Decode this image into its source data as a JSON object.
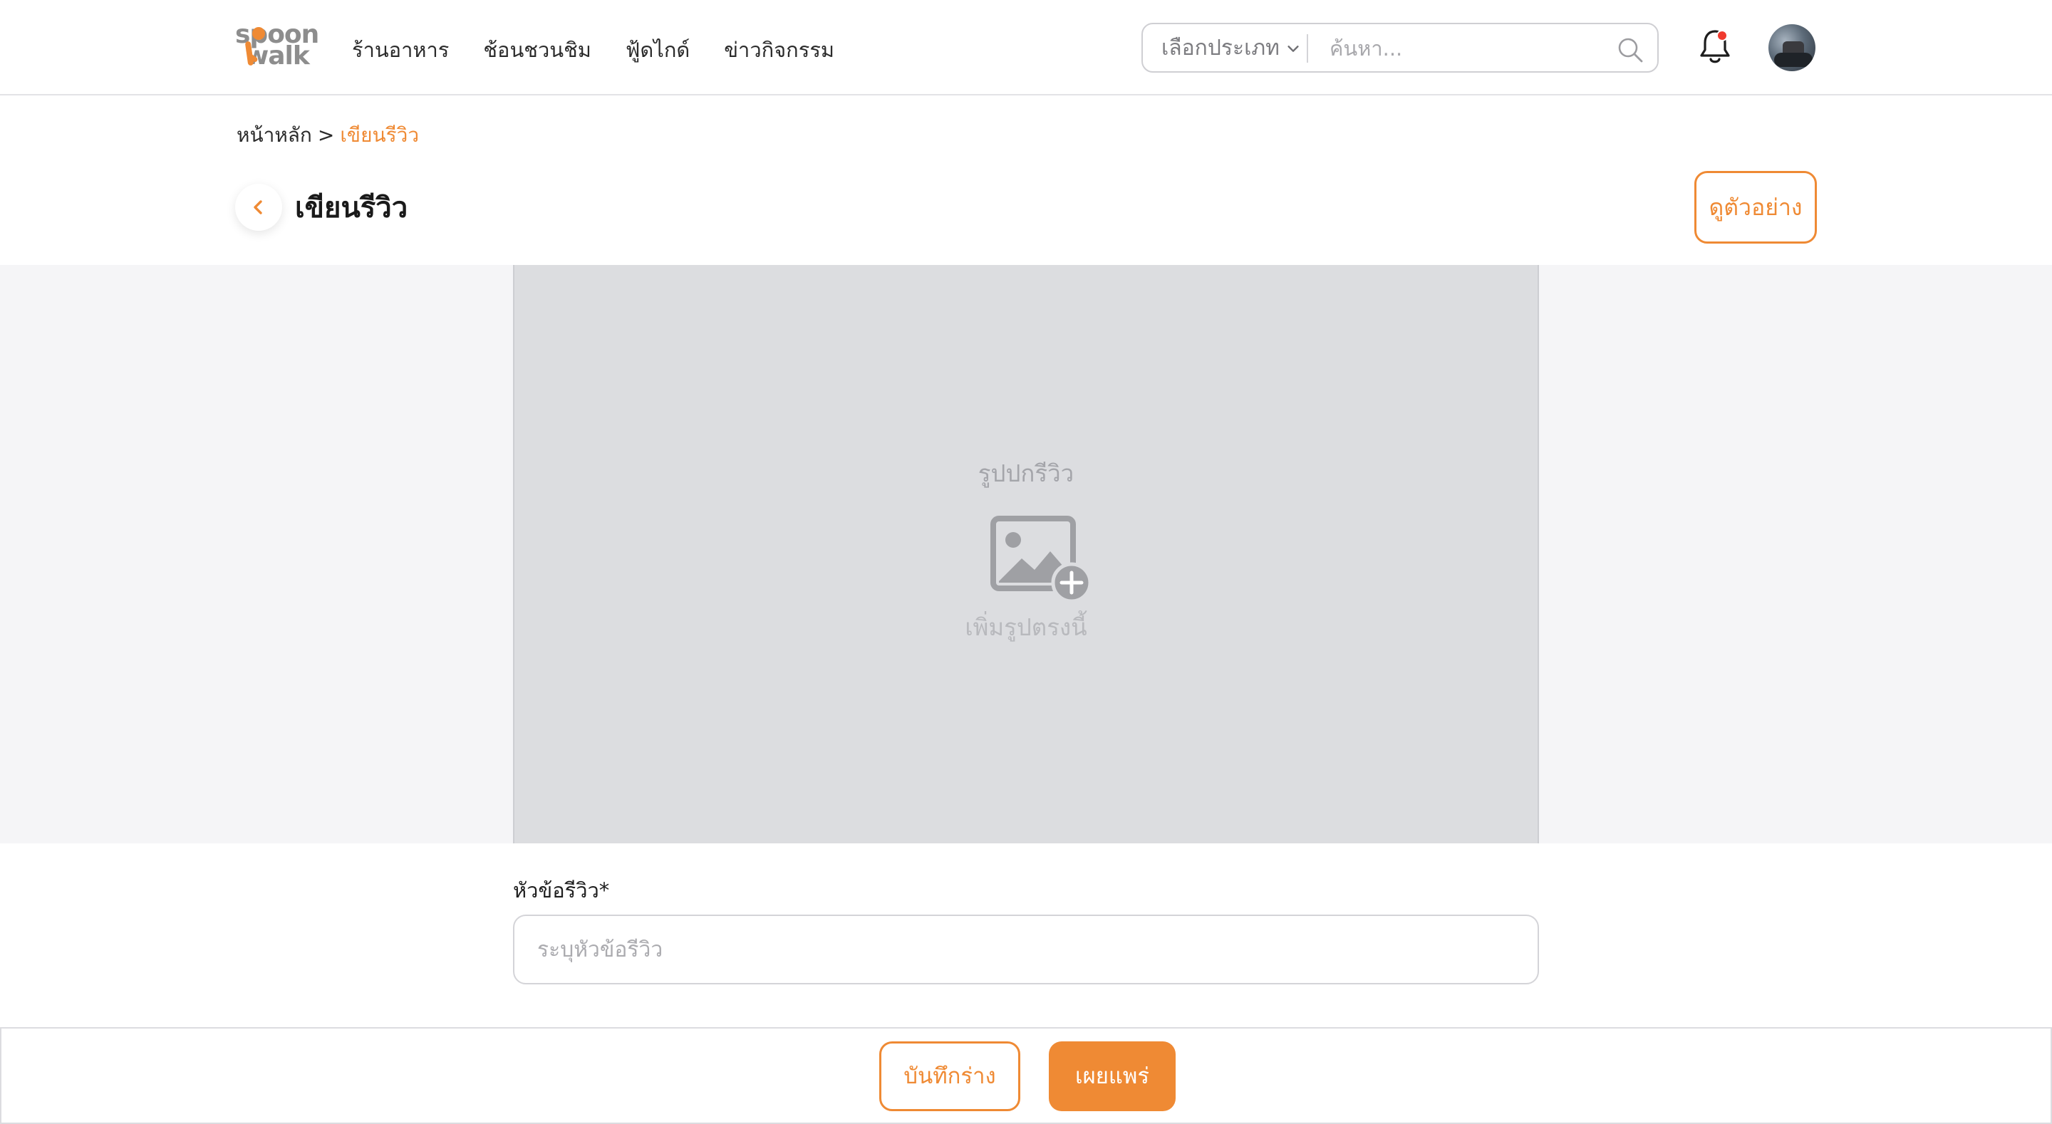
{
  "header": {
    "logo": {
      "line1": "spoon",
      "line2": "walk"
    },
    "nav": [
      {
        "label": "ร้านอาหาร"
      },
      {
        "label": "ช้อนชวนชิม"
      },
      {
        "label": "ฟู้ดไกด์"
      },
      {
        "label": "ข่าวกิจกรรม"
      }
    ],
    "search": {
      "category_label": "เลือกประเภท",
      "placeholder": "ค้นหา...",
      "icon": "search-icon"
    },
    "notifications": {
      "icon": "bell-icon",
      "has_unread": true
    },
    "avatar": {
      "icon": "user-avatar"
    }
  },
  "breadcrumb": {
    "home": "หน้าหลัก",
    "separator": ">",
    "current": "เขียนรีวิว"
  },
  "page": {
    "title": "เขียนรีวิว",
    "back_icon": "chevron-left-icon",
    "preview_label": "ดูตัวอย่าง"
  },
  "cover": {
    "label": "รูปปกรีวิว",
    "icon": "image-add-icon",
    "add_text": "เพิ่มรูปตรงนี้"
  },
  "form": {
    "title_label": "หัวข้อรีวิว*",
    "title_placeholder": "ระบุหัวข้อรีวิว",
    "title_value": ""
  },
  "footer": {
    "draft_label": "บันทึกร่าง",
    "publish_label": "เผยแพร่"
  },
  "colors": {
    "accent": "#ef8a34",
    "notification_dot": "#f03a2e",
    "cover_bg": "#dcdde0",
    "band_bg": "#f5f5f7"
  }
}
